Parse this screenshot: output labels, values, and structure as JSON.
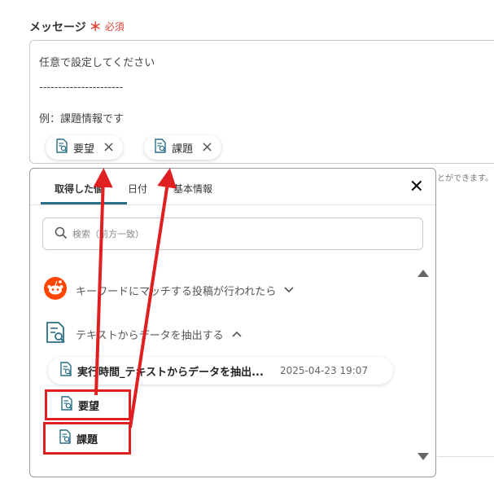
{
  "field": {
    "label": "メッセージ",
    "required_mark": "＊",
    "required_text": "必須"
  },
  "message": {
    "line1": "任意で設定してください",
    "line2": "----------------------",
    "line3": "例：課題情報です"
  },
  "chips": [
    {
      "label": "要望",
      "icon": "document-search-icon"
    },
    {
      "label": "課題",
      "icon": "document-search-icon"
    }
  ],
  "hint_text": "とができます。",
  "panel": {
    "tabs": [
      "取得した値",
      "日付",
      "基本情報"
    ],
    "search_placeholder": "検索（前方一致）",
    "sections": [
      {
        "label": "キーワードにマッチする投稿が行われたら",
        "icon": "reddit-icon",
        "expanded": false
      },
      {
        "label": "テキストからデータを抽出する",
        "icon": "document-search-icon",
        "expanded": true
      }
    ],
    "result_row": {
      "name": "実行時間_テキストからデータを抽出...",
      "date": "2025-04-23 19:07"
    },
    "items": [
      "要望",
      "課題"
    ]
  },
  "colors": {
    "required": "#e0453a",
    "tab_active": "#2a6f86",
    "annotation": "#e02020"
  }
}
